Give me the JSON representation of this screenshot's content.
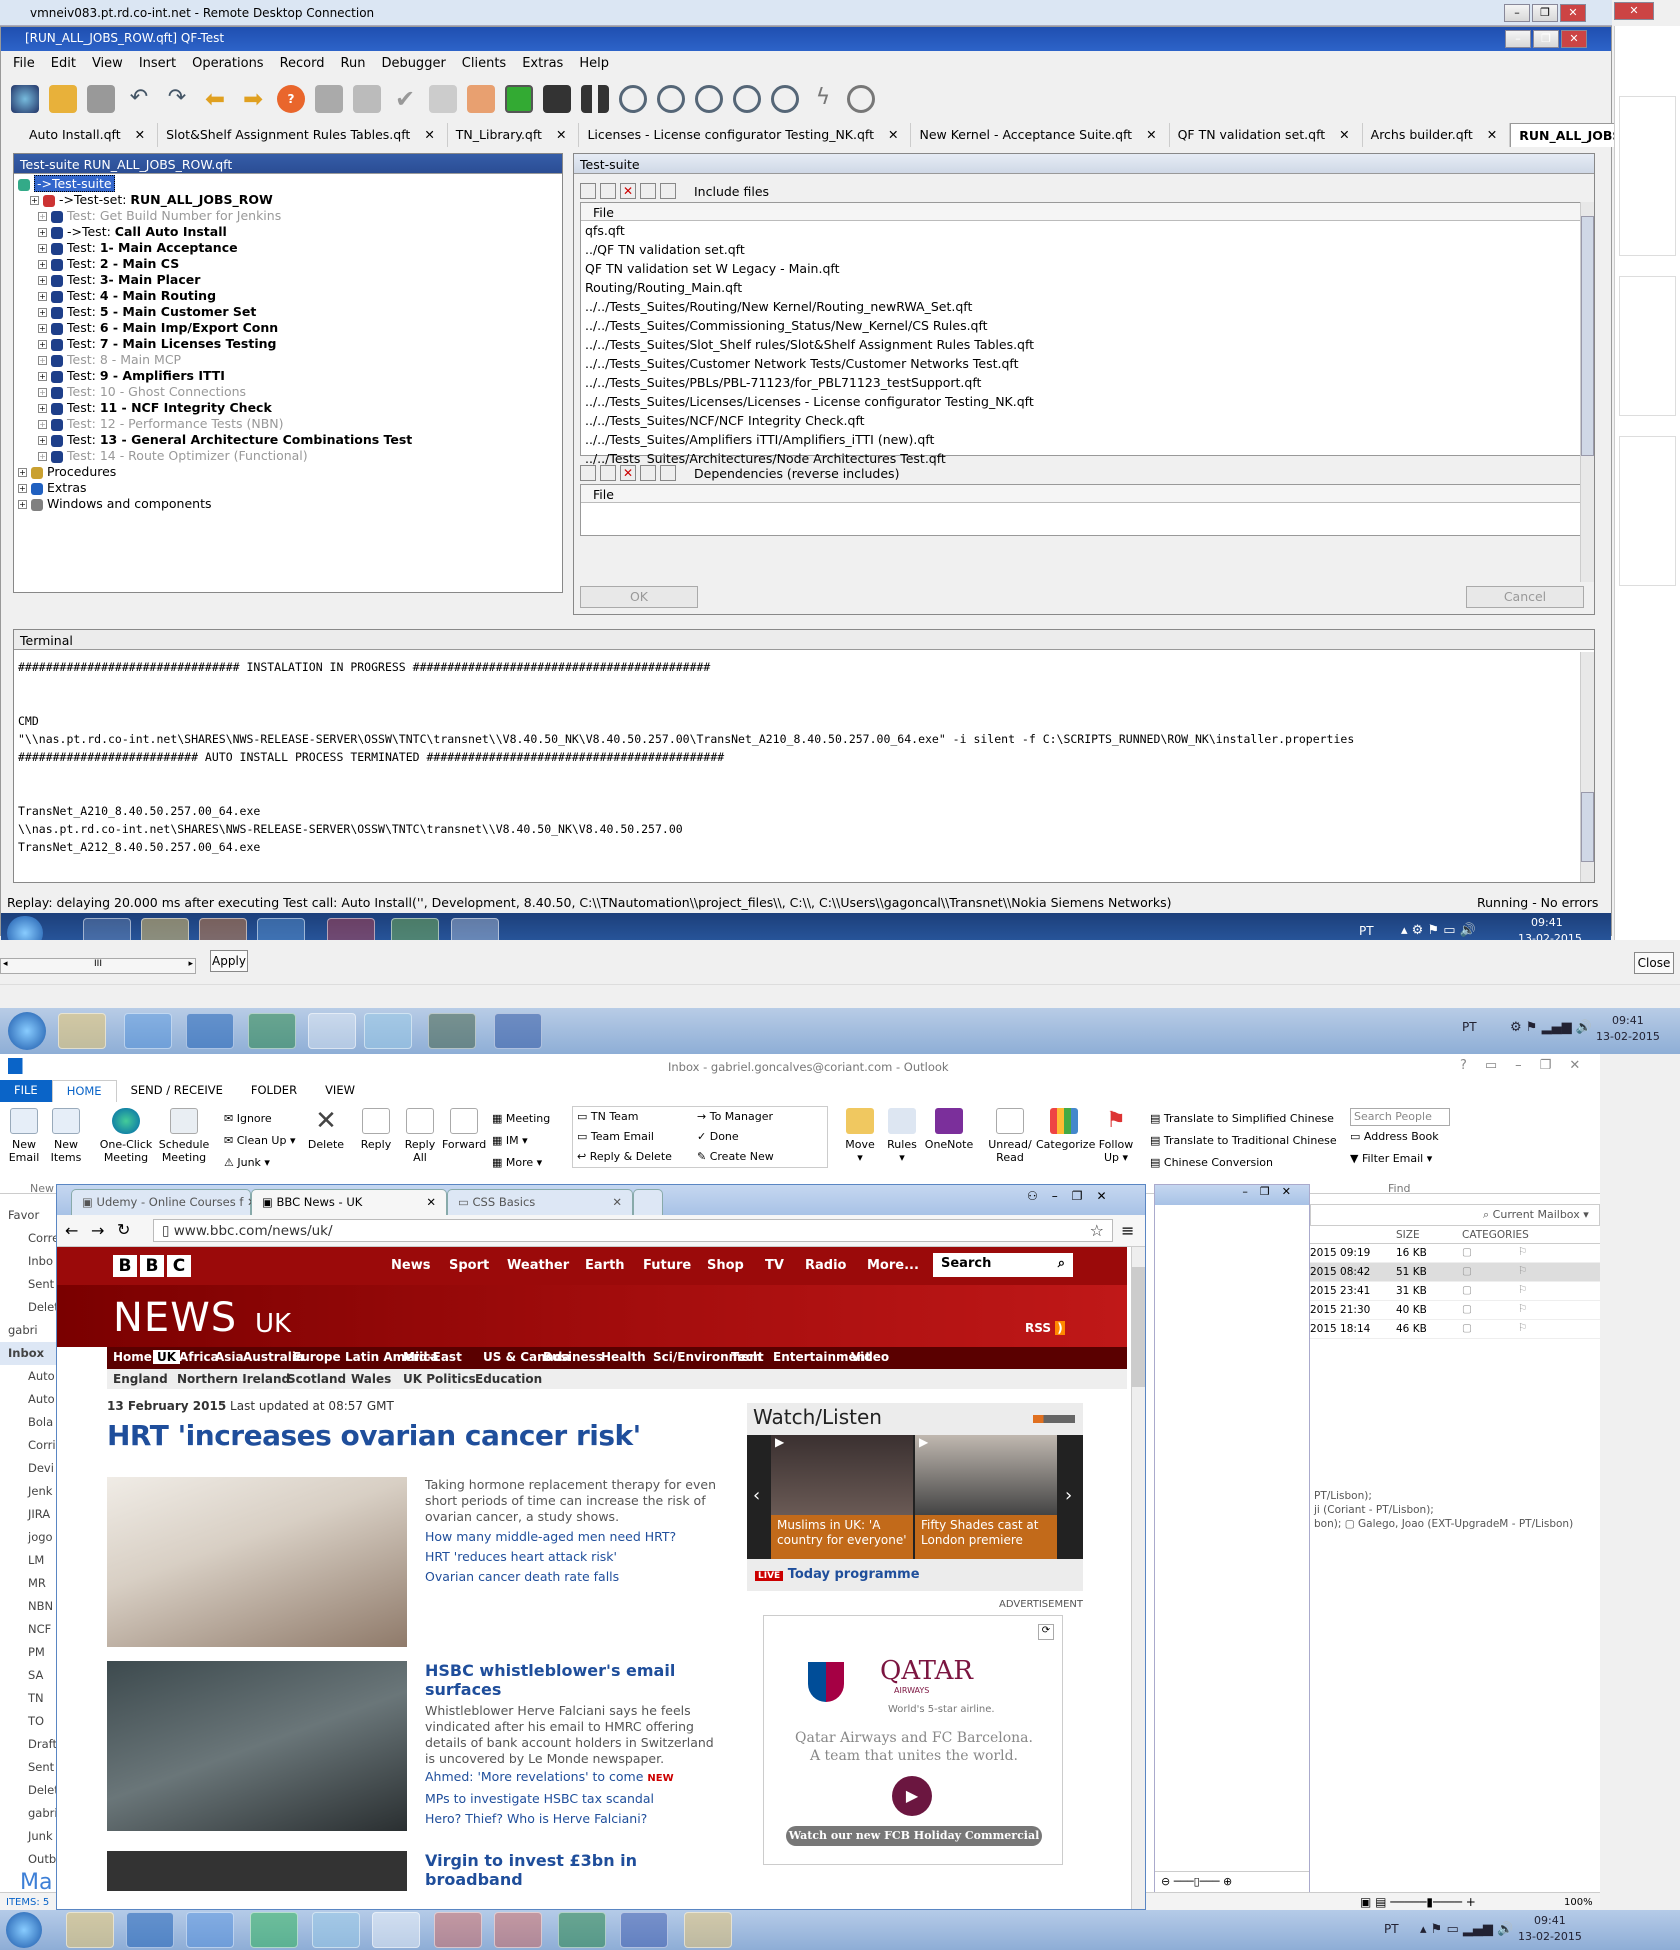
{
  "rdp": {
    "title": "vmneiv083.pt.rd.co-int.net - Remote Desktop Connection"
  },
  "qf": {
    "title": "[RUN_ALL_JOBS_ROW.qft] QF-Test",
    "menu": [
      "File",
      "Edit",
      "View",
      "Insert",
      "Operations",
      "Record",
      "Run",
      "Debugger",
      "Clients",
      "Extras",
      "Help"
    ],
    "tabs": [
      "Auto Install.qft",
      "Slot&Shelf Assignment Rules Tables.qft",
      "TN_Library.qft",
      "Licenses - License configurator Testing_NK.qft",
      "New Kernel - Acceptance Suite.qft",
      "QF TN validation set.qft",
      "Archs builder.qft",
      "RUN_ALL_JOBS_ROW.qft"
    ],
    "tree_header": "Test-suite RUN_ALL_JOBS_ROW.qft",
    "tree": [
      {
        "prefix": "",
        "label": "->Test-suite",
        "muted": false,
        "level": 0,
        "root": true
      },
      {
        "prefix": "->Test-set: ",
        "label": "RUN_ALL_JOBS_ROW",
        "muted": false,
        "level": 1
      },
      {
        "prefix": "Test: ",
        "label": "Get Build Number for Jenkins",
        "muted": true,
        "level": 2
      },
      {
        "prefix": "->Test: ",
        "label": "Call Auto Install",
        "muted": false,
        "level": 2
      },
      {
        "prefix": "Test: ",
        "label": "1- Main Acceptance",
        "muted": false,
        "level": 2
      },
      {
        "prefix": "Test: ",
        "label": "2 - Main CS",
        "muted": false,
        "level": 2
      },
      {
        "prefix": "Test: ",
        "label": "3- Main Placer",
        "muted": false,
        "level": 2
      },
      {
        "prefix": "Test: ",
        "label": "4 - Main Routing",
        "muted": false,
        "level": 2
      },
      {
        "prefix": "Test: ",
        "label": "5 - Main Customer Set",
        "muted": false,
        "level": 2
      },
      {
        "prefix": "Test: ",
        "label": "6 - Main Imp/Export Conn",
        "muted": false,
        "level": 2
      },
      {
        "prefix": "Test: ",
        "label": "7 - Main Licenses Testing",
        "muted": false,
        "level": 2
      },
      {
        "prefix": "Test: ",
        "label": "8 - Main MCP",
        "muted": true,
        "level": 2
      },
      {
        "prefix": "Test: ",
        "label": "9 - Amplifiers ITTI",
        "muted": false,
        "level": 2
      },
      {
        "prefix": "Test: ",
        "label": "10 - Ghost Connections",
        "muted": true,
        "level": 2
      },
      {
        "prefix": "Test: ",
        "label": "11 - NCF Integrity Check",
        "muted": false,
        "level": 2
      },
      {
        "prefix": "Test: ",
        "label": "12 - Performance Tests (NBN)",
        "muted": true,
        "level": 2
      },
      {
        "prefix": "Test: ",
        "label": "13 - General Architecture Combinations Test",
        "muted": false,
        "level": 2
      },
      {
        "prefix": "Test: ",
        "label": "14 - Route Optimizer (Functional)",
        "muted": true,
        "level": 2
      },
      {
        "prefix": "",
        "label": "Procedures",
        "muted": false,
        "level": 0
      },
      {
        "prefix": "",
        "label": "Extras",
        "muted": false,
        "level": 0
      },
      {
        "prefix": "",
        "label": "Windows and components",
        "muted": false,
        "level": 0
      }
    ],
    "props_header": "Test-suite",
    "include_label": "Include files",
    "file_col": "File",
    "include_files": [
      "qfs.qft",
      "../QF TN validation set.qft",
      "QF TN validation set W Legacy - Main.qft",
      "Routing/Routing_Main.qft",
      "../../Tests_Suites/Routing/New Kernel/Routing_newRWA_Set.qft",
      "../../Tests_Suites/Commissioning_Status/New_Kernel/CS Rules.qft",
      "../../Tests_Suites/Slot_Shelf rules/Slot&Shelf Assignment Rules Tables.qft",
      "../../Tests_Suites/Customer Network Tests/Customer Networks Test.qft",
      "../../Tests_Suites/PBLs/PBL-71123/for_PBL71123_testSupport.qft",
      "../../Tests_Suites/Licenses/Licenses - License configurator Testing_NK.qft",
      "../../Tests_Suites/NCF/NCF Integrity Check.qft",
      "../../Tests_Suites/Amplifiers iTTI/Amplifiers_iTTI (new).qft",
      "../../Tests_Suites/Architectures/Node Architectures Test.qft"
    ],
    "deps_label": "Dependencies (reverse includes)",
    "ok": "OK",
    "cancel": "Cancel",
    "terminal_header": "Terminal",
    "terminal_lines": [
      "################################ INSTALATION IN PROGRESS ###########################################",
      "",
      "",
      "CMD",
      "\"\\\\nas.pt.rd.co-int.net\\SHARES\\NWS-RELEASE-SERVER\\OSSW\\TNTC\\transnet\\\\V8.40.50_NK\\V8.40.50.257.00\\TransNet_A210_8.40.50.257.00_64.exe\" -i silent -f C:\\SCRIPTS_RUNNED\\ROW_NK\\installer.properties",
      "########################## AUTO INSTALL PROCESS TERMINATED ###########################################",
      "",
      "",
      "TransNet_A210_8.40.50.257.00_64.exe",
      "\\\\nas.pt.rd.co-int.net\\SHARES\\NWS-RELEASE-SERVER\\OSSW\\TNTC\\transnet\\\\V8.40.50_NK\\V8.40.50.257.00",
      "TransNet_A212_8.40.50.257.00_64.exe"
    ],
    "status_left": "Replay: delaying 20.000 ms after executing Test call: Auto Install('', Development, 8.40.50, C:\\\\TNautomation\\\\project_files\\\\, C:\\\\, C:\\\\Users\\\\gagoncal\\\\Transnet\\\\Nokia Siemens Networks)",
    "status_right": "Running - No errors",
    "tray_lang": "PT",
    "tray_time": "09:41",
    "tray_date": "13-02-2015"
  },
  "local": {
    "apply": "Apply",
    "close": "Close",
    "scroll_mid": "III",
    "tray_lang": "PT",
    "tray_time": "09:41",
    "tray_date": "13-02-2015"
  },
  "outlook": {
    "title": "Inbox - gabriel.goncalves@coriant.com - Outlook",
    "tabs": [
      "FILE",
      "HOME",
      "SEND / RECEIVE",
      "FOLDER",
      "VIEW"
    ],
    "ribbon": {
      "new_email": "New Email",
      "new_items": "New Items",
      "one_click": "One-Click Meeting",
      "schedule": "Schedule Meeting",
      "ignore": "Ignore",
      "cleanup": "Clean Up",
      "junk": "Junk",
      "delete": "Delete",
      "reply": "Reply",
      "reply_all": "Reply All",
      "forward": "Forward",
      "meeting": "Meeting",
      "im": "IM",
      "more": "More",
      "tn_team": "TN Team",
      "team_email": "Team Email",
      "reply_delete": "Reply & Delete",
      "to_manager": "To Manager",
      "done": "Done",
      "create_new": "Create New",
      "move": "Move",
      "rules": "Rules",
      "onenote": "OneNote",
      "unread": "Unread/ Read",
      "categorize": "Categorize",
      "follow": "Follow Up",
      "translate_s": "Translate to Simplified Chinese",
      "translate_t": "Translate to Traditional Chinese",
      "chinese_conv": "Chinese Conversion",
      "search_people": "Search People",
      "address_book": "Address Book",
      "filter_email": "Filter Email",
      "find": "Find",
      "new_label": "New"
    },
    "folders": [
      "Favor",
      "Corre",
      "Inbo",
      "Sent I",
      "Delet",
      "gabri",
      "Inbox",
      "Auto",
      "Auto",
      "Bola",
      "Corri",
      "Devi",
      "Jenk",
      "JIRA",
      "jogo",
      "LM",
      "MR",
      "NBN",
      "NCF",
      "PM",
      "SA",
      "TN",
      "TO",
      "Drafts",
      "Sent I",
      "Delet",
      "gabrie",
      "Junk E",
      "Outb"
    ],
    "mail_head": {
      "search": "Current Mailbox",
      "size": "SIZE",
      "categories": "CATEGORIES"
    },
    "mail_rows": [
      {
        "date": "2015 09:19",
        "size": "16 KB"
      },
      {
        "date": "2015 08:42",
        "size": "51 KB"
      },
      {
        "date": "2015 23:41",
        "size": "31 KB"
      },
      {
        "date": "2015 21:30",
        "size": "40 KB"
      },
      {
        "date": "2015 18:14",
        "size": "46 KB"
      }
    ],
    "reading": [
      "PT/Lisbon);",
      "ji (Coriant - PT/Lisbon);",
      "bon);",
      "Galego, Joao (EXT-UpgradeM - PT/Lisbon)"
    ],
    "items": "ITEMS: 5",
    "zoom": "100%",
    "ma": "Ma"
  },
  "chrome": {
    "tabs": [
      "Udemy - Online Courses f",
      "BBC News - UK",
      "CSS Basics"
    ],
    "url": "www.bbc.com/news/uk/"
  },
  "bbc": {
    "nav": [
      "News",
      "Sport",
      "Weather",
      "Earth",
      "Future",
      "Shop",
      "TV",
      "Radio",
      "More..."
    ],
    "search": "Search",
    "news": "NEWS",
    "uk": "UK",
    "rss": "RSS",
    "regions": [
      "Home",
      "UK",
      "Africa",
      "Asia",
      "Australia",
      "Europe",
      "Latin America",
      "Mid-East",
      "US & Canada",
      "Business",
      "Health",
      "Sci/Environment",
      "Tech",
      "Entertainment",
      "Video"
    ],
    "subregions": [
      "England",
      "Northern Ireland",
      "Scotland",
      "Wales",
      "UK Politics",
      "Education"
    ],
    "date": "13 February 2015",
    "updated": "Last updated at 08:57 GMT",
    "lead_title": "HRT 'increases ovarian cancer risk'",
    "lead_summary": "Taking hormone replacement therapy for even short periods of time can increase the risk of ovarian cancer, a study shows.",
    "lead_links": [
      "How many middle-aged men need HRT?",
      "HRT 'reduces heart attack risk'",
      "Ovarian cancer death rate falls"
    ],
    "s2_title": "HSBC whistleblower's email surfaces",
    "s2_summary": "Whistleblower Herve Falciani says he feels vindicated after his email to HMRC offering details of bank account holders in Switzerland is uncovered by Le Monde newspaper.",
    "s2_links": [
      "Ahmed: 'More revelations' to come",
      "MPs to investigate HSBC tax scandal",
      "Hero? Thief? Who is Herve Falciani?"
    ],
    "new_badge": "NEW",
    "s3_title": "Virgin to invest £3bn in broadband",
    "watch": "Watch/Listen",
    "cap1": "Muslims in UK: 'A country for everyone'",
    "cap2": "Fifty Shades cast at London premiere",
    "live": "LIVE",
    "today": "Today programme",
    "advert": "ADVERTISEMENT",
    "qatar": "QATAR",
    "airways": "AIRWAYS",
    "tagline": "World's 5-star airline.",
    "ad_line1": "Qatar Airways and FC Barcelona.",
    "ad_line2": "A team that unites the world.",
    "ad_button": "Watch our new FCB Holiday Commercial"
  },
  "win7": {
    "lang": "PT",
    "time": "09:41",
    "date": "13-02-2015"
  }
}
